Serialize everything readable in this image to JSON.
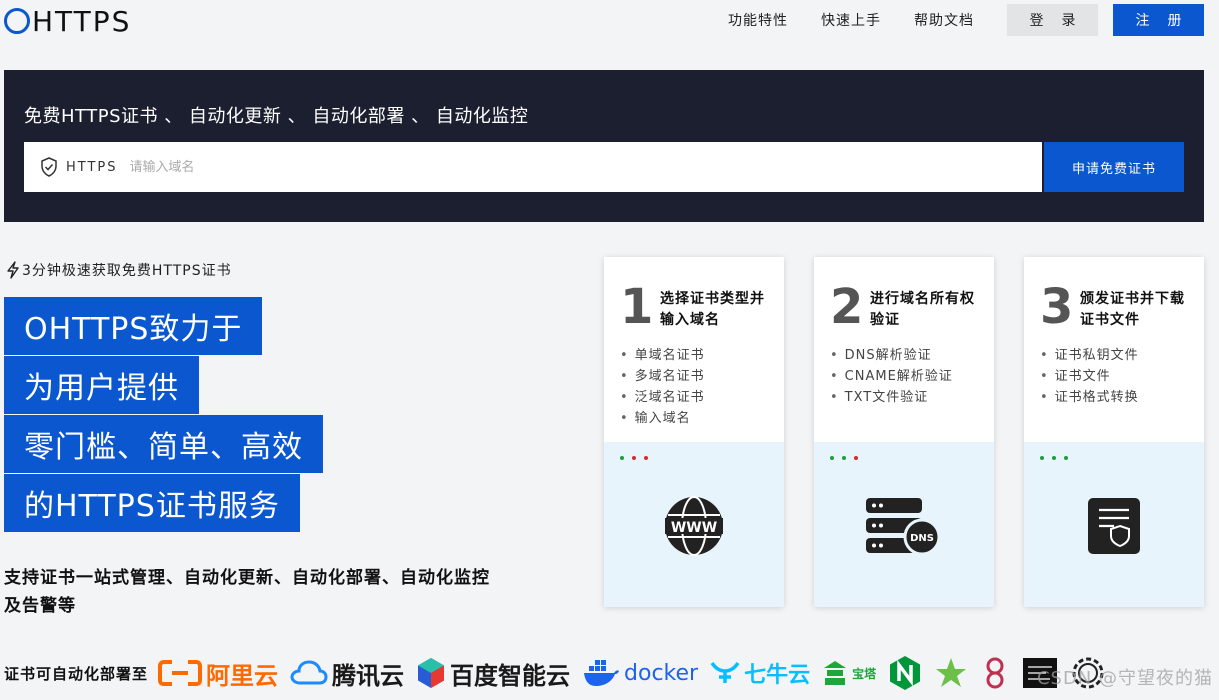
{
  "header": {
    "logo_text": "HTTPS",
    "nav": [
      "功能特性",
      "快速上手",
      "帮助文档"
    ],
    "login_label": "登录",
    "register_label": "注册"
  },
  "hero": {
    "tagline": "免费HTTPS证书 、 自动化更新 、 自动化部署 、 自动化监控",
    "input_prefix": "HTTPS",
    "input_placeholder": "请输入域名",
    "apply_button": "申请免费证书"
  },
  "promo": {
    "subtag": "3分钟极速获取免费HTTPS证书",
    "headline_lines": [
      "OHTTPS致力于",
      "为用户提供",
      "零门槛、简单、高效",
      "的HTTPS证书服务"
    ],
    "support_text": "支持证书一站式管理、自动化更新、自动化部署、自动化监控及告警等"
  },
  "steps": [
    {
      "num": "1",
      "title": "选择证书类型并输入域名",
      "items": [
        "单域名证书",
        "多域名证书",
        "泛域名证书",
        "输入域名"
      ],
      "icon": "www-globe-icon"
    },
    {
      "num": "2",
      "title": "进行域名所有权验证",
      "items": [
        "DNS解析验证",
        "CNAME解析验证",
        "TXT文件验证"
      ],
      "icon": "dns-server-icon"
    },
    {
      "num": "3",
      "title": "颁发证书并下载证书文件",
      "items": [
        "证书私钥文件",
        "证书文件",
        "证书格式转换"
      ],
      "icon": "certificate-file-icon"
    }
  ],
  "partners": {
    "label": "证书可自动化部署至",
    "logos": [
      {
        "name": "阿里云",
        "color": "#ff6a00"
      },
      {
        "name": "腾讯云",
        "color": "#1a1a1a"
      },
      {
        "name": "百度智能云",
        "color": "#1a1a1a"
      },
      {
        "name": "docker",
        "color": "#1d63ed"
      },
      {
        "name": "七牛云",
        "color": "#07beff"
      },
      {
        "name": "宝塔",
        "color": "#20a53a"
      }
    ]
  },
  "watermark": "CSDN @守望夜的猫",
  "colors": {
    "brand": "#0b57d0",
    "banner": "#1b1f30",
    "card_bottom": "#e8f4fb"
  }
}
